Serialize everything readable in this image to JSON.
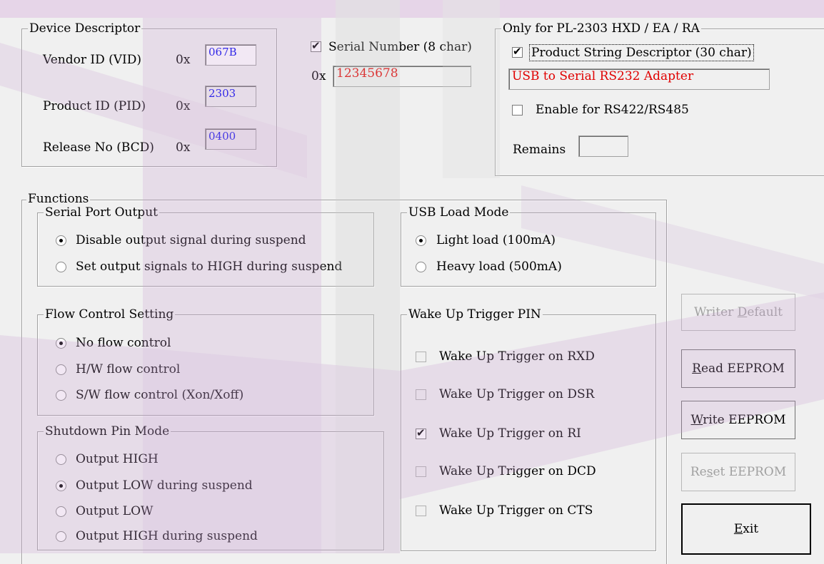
{
  "device_descriptor": {
    "title": "Device Descriptor",
    "vid_label": "Vendor ID (VID)",
    "vid_value": "067B",
    "pid_label": "Product ID (PID)",
    "pid_value": "2303",
    "release_label": "Release No (BCD)",
    "release_value": "0400",
    "hex_prefix": "0x"
  },
  "serial": {
    "label": "Serial Number (8 char)",
    "checked": true,
    "prefix": "0x",
    "value": "12345678"
  },
  "pl2303": {
    "title": "Only for PL-2303 HXD / EA / RA",
    "product_string_label": "Product String Descriptor (30 char)",
    "product_string_checked": true,
    "product_string_value": "USB to Serial RS232 Adapter",
    "rs422_label": "Enable for RS422/RS485",
    "rs422_checked": false,
    "remains_label": "Remains",
    "remains_value": ""
  },
  "functions": {
    "title": "Functions",
    "serial_port_output": {
      "title": "Serial Port Output",
      "options": [
        "Disable output signal during suspend",
        "Set output signals to HIGH during suspend"
      ],
      "selected": 0
    },
    "usb_load_mode": {
      "title": "USB Load Mode",
      "options": [
        "Light load (100mA)",
        "Heavy load (500mA)"
      ],
      "selected": 0
    },
    "flow_control": {
      "title": "Flow Control Setting",
      "options": [
        "No flow control",
        "H/W flow control",
        "S/W flow control (Xon/Xoff)"
      ],
      "selected": 0
    },
    "wake_up": {
      "title": "Wake Up Trigger PIN",
      "items": [
        {
          "label": "Wake Up Trigger on RXD",
          "checked": false
        },
        {
          "label": "Wake Up Trigger on DSR",
          "checked": false
        },
        {
          "label": "Wake Up Trigger on RI",
          "checked": true
        },
        {
          "label": "Wake Up Trigger on DCD",
          "checked": false
        },
        {
          "label": "Wake Up Trigger on CTS",
          "checked": false
        }
      ]
    },
    "shutdown_pin": {
      "title": "Shutdown Pin Mode",
      "options": [
        "Output HIGH",
        "Output LOW during suspend",
        "Output LOW",
        "Output HIGH during suspend"
      ],
      "selected": 1
    }
  },
  "buttons": {
    "writer_default": {
      "pre": "Writer ",
      "accel": "D",
      "post": "efault"
    },
    "read_eeprom": {
      "pre": "",
      "accel": "R",
      "post": "ead EEPROM"
    },
    "write_eeprom": {
      "pre": "",
      "accel": "W",
      "post": "rite EEPROM"
    },
    "reset_eeprom": {
      "pre": "Re",
      "accel": "s",
      "post": "et EEPROM"
    },
    "exit": {
      "pre": "",
      "accel": "E",
      "post": "xit"
    }
  },
  "theme": {
    "overlay_purple": "#c9a3d2",
    "overlay_grey": "#cfcfcf",
    "field_blue": "#0000ee",
    "field_red": "#e00000"
  },
  "check_mark": "✔"
}
